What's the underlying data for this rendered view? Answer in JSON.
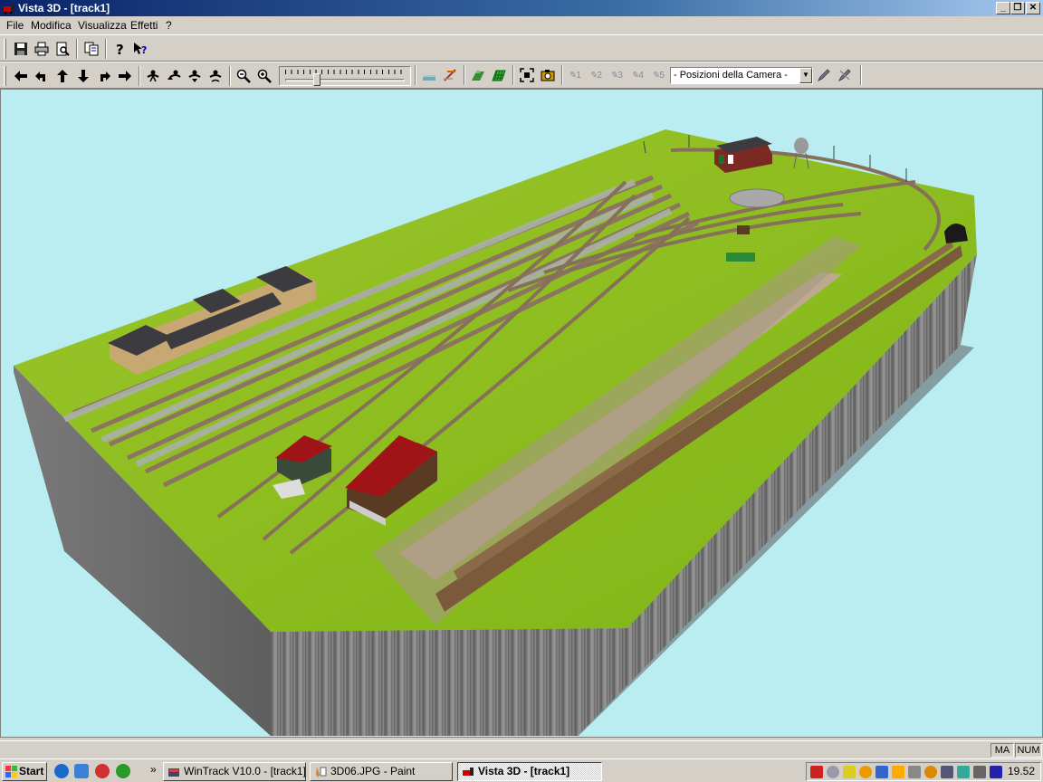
{
  "window": {
    "title": "Vista 3D - [track1]",
    "controls": [
      "minimize",
      "restore",
      "close"
    ]
  },
  "menu": {
    "items": [
      "File",
      "Modifica",
      "Visualizza",
      "Effetti",
      "?"
    ]
  },
  "toolbar1": {
    "icons": [
      "save-icon",
      "print-icon",
      "print-preview-icon",
      "copy-icon",
      "help-icon",
      "context-help-icon"
    ]
  },
  "toolbar2": {
    "nav_icons": [
      "arrow-left-icon",
      "rotate-left-icon",
      "arrow-up-icon",
      "arrow-down-icon",
      "rotate-right-icon",
      "arrow-right-icon"
    ],
    "walk_icons": [
      "walker-icon",
      "walker-up-icon",
      "walker-down-icon",
      "walker-spin-icon"
    ],
    "zoom_icons": [
      "zoom-out-icon",
      "zoom-in-icon"
    ],
    "zoom_level": 0.25,
    "scene_icons": [
      "terrain-icon",
      "track-icon",
      "landscape-icon",
      "grid-icon",
      "fit-view-icon",
      "camera-icon"
    ],
    "camera_presets": [
      "1",
      "2",
      "3",
      "4",
      "5"
    ],
    "camera_select": "- Posizioni della Camera -",
    "camera_tools": [
      "camera-edit-icon",
      "camera-delete-icon"
    ]
  },
  "status": {
    "panels": [
      "MA",
      "NUM"
    ]
  },
  "taskbar": {
    "start": "Start",
    "tasks": [
      {
        "label": "WinTrack  V10.0 - [track1]",
        "active": false
      },
      {
        "label": "3D06.JPG - Paint",
        "active": false
      },
      {
        "label": "Vista 3D - [track1]",
        "active": true
      }
    ],
    "clock": "19.52"
  },
  "colors": {
    "title_start": "#0a246a",
    "sky": "#b9edf1",
    "grass": "#8fc31e",
    "cliff": "#7a7a7a",
    "roof_red": "#a01418",
    "roof_dark": "#3c3c40",
    "building": "#c8a872"
  }
}
